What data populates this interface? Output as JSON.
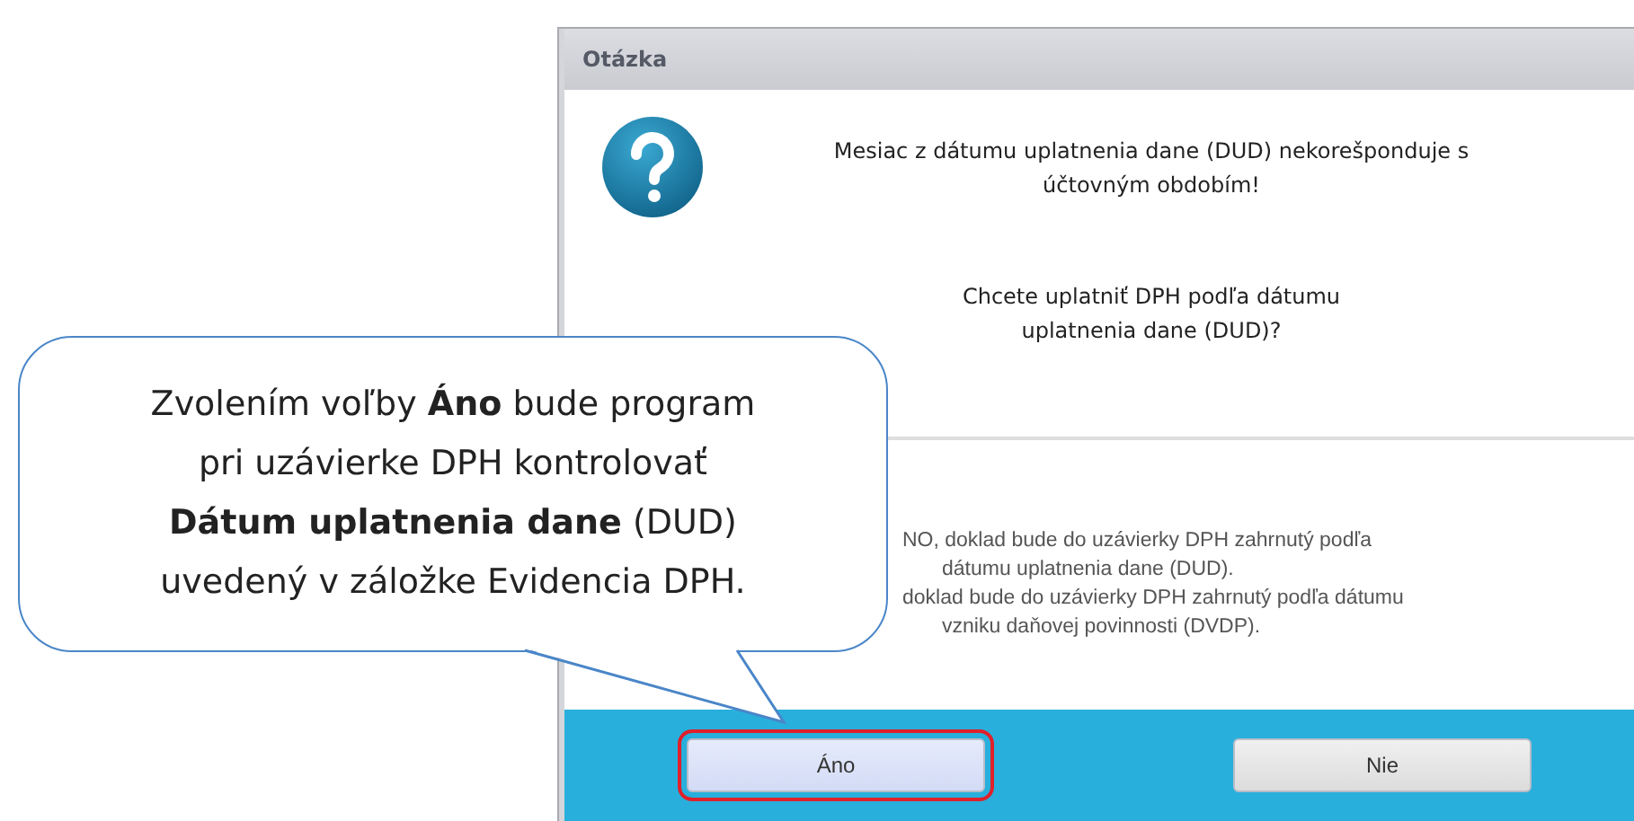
{
  "dialog": {
    "title": "Otázka",
    "message_lines": [
      "Mesiac z dátumu uplatnenia dane (DUD) nekorešponduje s",
      "účtovným obdobím!"
    ],
    "question_lines": [
      "Chcete uplatniť DPH podľa dátumu",
      "uplatnenia dane (DUD)?"
    ],
    "notes": [
      {
        "lines": [
          "NO, doklad bude do uzávierky DPH zahrnutý podľa",
          "dátumu uplatnenia dane (DUD)."
        ]
      },
      {
        "lines": [
          "doklad bude do uzávierky DPH zahrnutý podľa dátumu",
          "vzniku daňovej povinnosti (DVDP)."
        ]
      }
    ],
    "buttons": [
      {
        "label": "Áno",
        "highlighted": true
      },
      {
        "label": "Nie",
        "highlighted": false
      }
    ]
  },
  "callout": {
    "lines": [
      "Zvolením voľby **Áno** bude program",
      "pri uzávierke DPH kontrolovať",
      "**Dátum uplatnenia dane** (DUD)",
      "uvedený v záložke Evidencia DPH."
    ]
  }
}
